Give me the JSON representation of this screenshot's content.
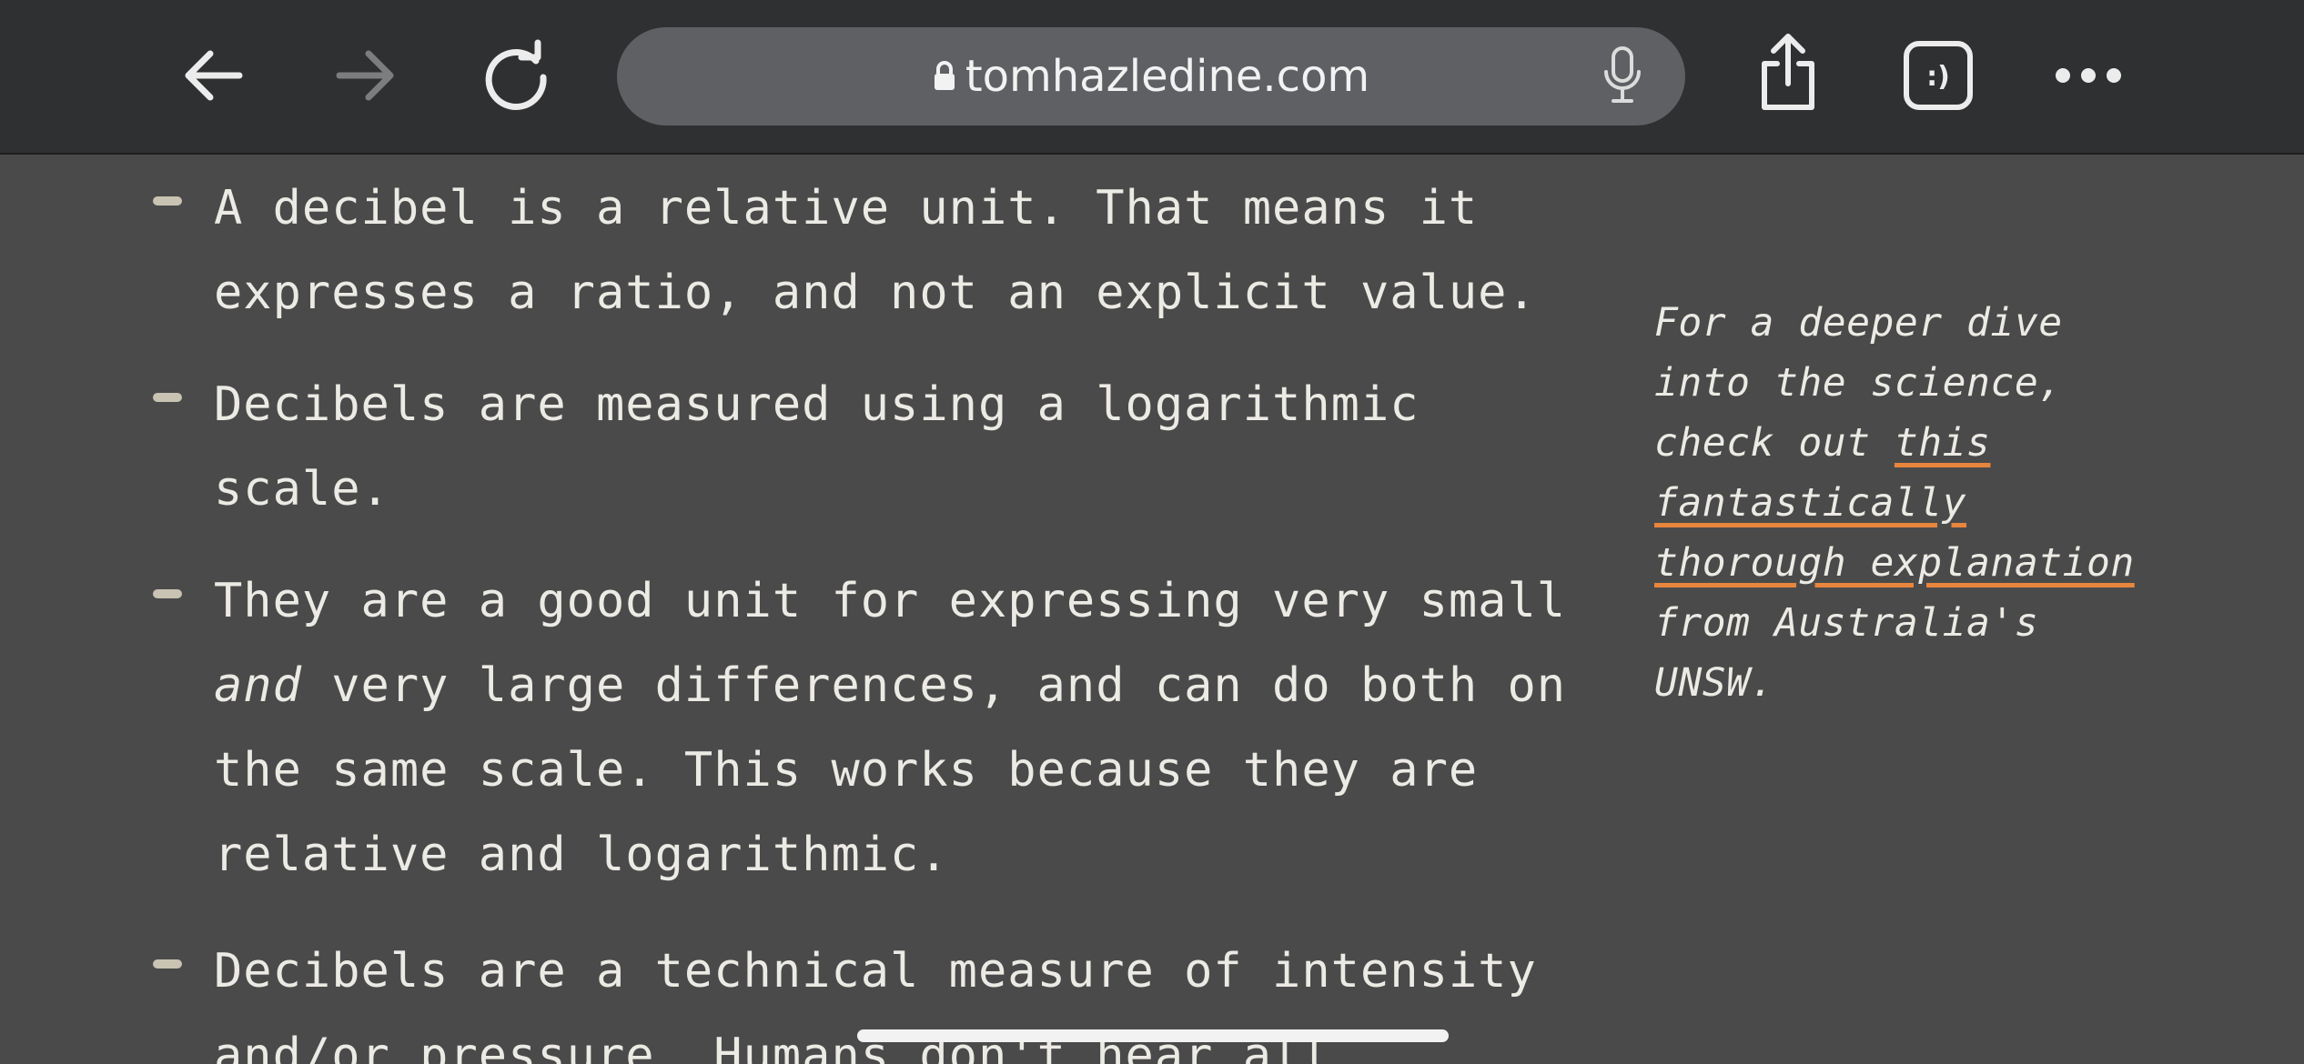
{
  "browser": {
    "url": "tomhazledine.com",
    "icons": {
      "back": "back-arrow-icon",
      "forward": "forward-arrow-icon",
      "reload": "reload-icon",
      "lock": "lock-icon",
      "microphone": "microphone-icon",
      "share": "share-icon",
      "tabs": "tabs-icon",
      "more": "more-icon"
    },
    "tabs_glyph": ":)"
  },
  "article": {
    "items": [
      {
        "text": "A decibel is a relative unit. That means it\nexpresses a ratio, and not an explicit value."
      },
      {
        "text": "Decibels are measured using a logarithmic\nscale."
      },
      {
        "text_pre": "They are a good unit for expressing very small\n",
        "emphasis": "and",
        "text_post": " very large differences, and can do both on\nthe same scale. This works because they are\nrelative and logarithmic."
      },
      {
        "text": "Decibels are a technical measure of intensity\nand/or pressure. Humans don't hear all"
      }
    ]
  },
  "aside": {
    "text_pre": "For a deeper dive into the science, check out ",
    "link_text": "this fantastically thorough explanation",
    "text_post": " from Australia's UNSW."
  },
  "colors": {
    "toolbar_bg": "#2f3031",
    "url_bar_bg": "#5e6063",
    "page_bg": "#4a4a4a",
    "text": "#eceae4",
    "link_underline": "#e8853d",
    "bullet_dash": "#c9c3b3"
  }
}
